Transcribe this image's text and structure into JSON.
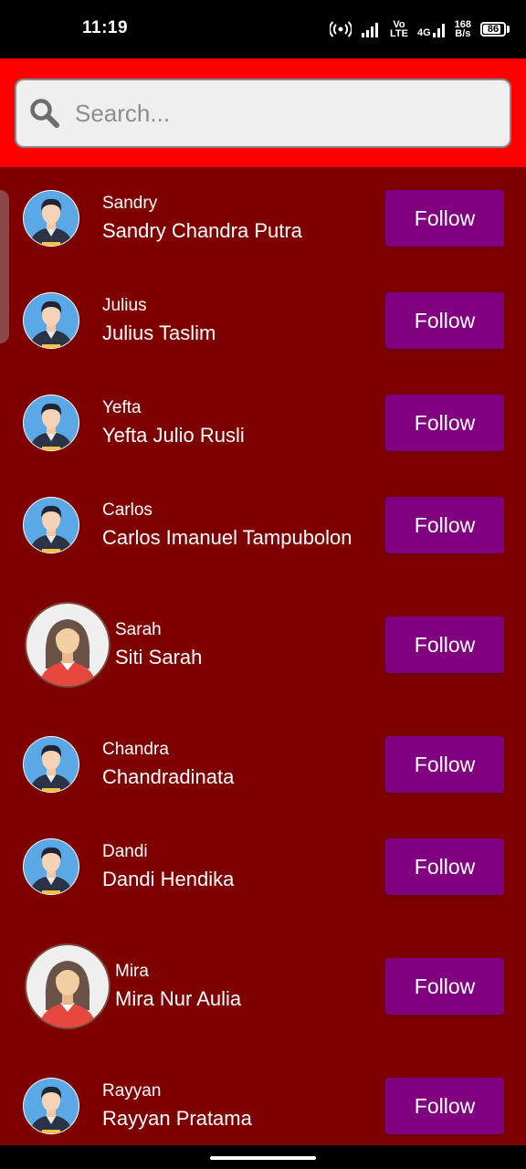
{
  "status_bar": {
    "time": "11:19",
    "network_vo": "Vo",
    "network_lte": "LTE",
    "network_4g": "4G",
    "speed_value": "168",
    "speed_unit": "B/s",
    "battery": "86",
    "battery_level": 0.86
  },
  "search": {
    "placeholder": "Search..."
  },
  "colors": {
    "header": "#ff0000",
    "list_background": "#7f0000",
    "follow_button": "#800080"
  },
  "users": [
    {
      "username": "Sandry",
      "fullname": "Sandry Chandra Putra",
      "avatar": "male",
      "follow_label": "Follow"
    },
    {
      "username": "Julius",
      "fullname": "Julius Taslim",
      "avatar": "male",
      "follow_label": "Follow"
    },
    {
      "username": "Yefta",
      "fullname": "Yefta Julio Rusli",
      "avatar": "male",
      "follow_label": "Follow"
    },
    {
      "username": "Carlos",
      "fullname": "Carlos Imanuel Tampubolon",
      "avatar": "male",
      "follow_label": "Follow"
    },
    {
      "username": "Sarah",
      "fullname": "Siti Sarah",
      "avatar": "female",
      "follow_label": "Follow"
    },
    {
      "username": "Chandra",
      "fullname": "Chandradinata",
      "avatar": "male",
      "follow_label": "Follow"
    },
    {
      "username": "Dandi",
      "fullname": "Dandi Hendika",
      "avatar": "male",
      "follow_label": "Follow"
    },
    {
      "username": "Mira",
      "fullname": "Mira Nur Aulia",
      "avatar": "female",
      "follow_label": "Follow"
    },
    {
      "username": "Rayyan",
      "fullname": "Rayyan Pratama",
      "avatar": "male",
      "follow_label": "Follow"
    }
  ]
}
